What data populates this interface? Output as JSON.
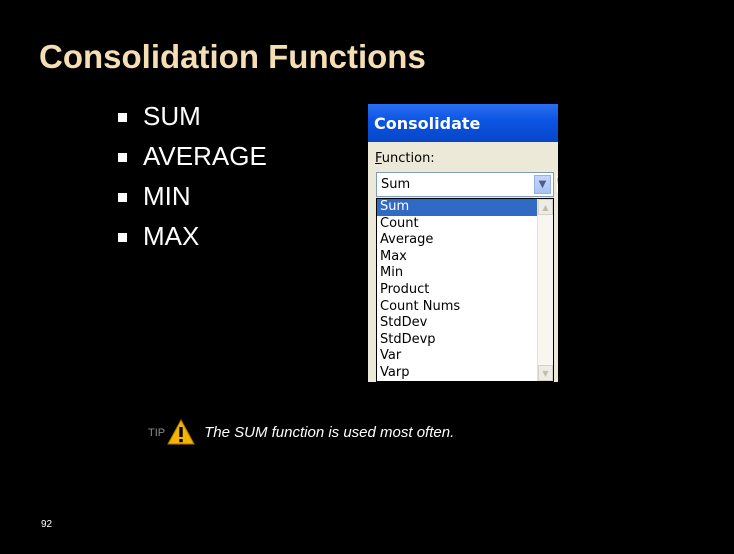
{
  "slide": {
    "title": "Consolidation Functions",
    "bullets": [
      "SUM",
      "AVERAGE",
      "MIN",
      "MAX"
    ],
    "page_number": "92"
  },
  "dialog": {
    "title": "Consolidate",
    "function_label_first": "F",
    "function_label_rest": "unction:",
    "selected_value": "Sum",
    "options": [
      "Sum",
      "Count",
      "Average",
      "Max",
      "Min",
      "Product",
      "Count Nums",
      "StdDev",
      "StdDevp",
      "Var",
      "Varp"
    ],
    "highlighted_option": "Sum",
    "colors": {
      "titlebar": "#0a54e3",
      "selection": "#316ac5",
      "dialog_bg": "#ece9d8"
    }
  },
  "tip": {
    "label": "TIP",
    "text": "The SUM function is used most often.",
    "icon": "warning-icon"
  },
  "colors": {
    "title": "#f5deb3",
    "background": "#000000",
    "text": "#ffffff"
  }
}
